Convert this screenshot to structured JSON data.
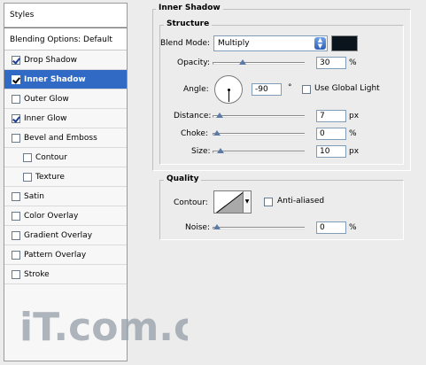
{
  "styles_panel": {
    "header": "Styles",
    "blending_options": "Blending Options: Default",
    "items": [
      {
        "label": "Drop Shadow",
        "checked": true
      },
      {
        "label": "Inner Shadow",
        "checked": true,
        "selected": true
      },
      {
        "label": "Outer Glow",
        "checked": false
      },
      {
        "label": "Inner Glow",
        "checked": true
      },
      {
        "label": "Bevel and Emboss",
        "checked": false
      },
      {
        "label": "Contour",
        "checked": false,
        "sub": true
      },
      {
        "label": "Texture",
        "checked": false,
        "sub": true
      },
      {
        "label": "Satin",
        "checked": false
      },
      {
        "label": "Color Overlay",
        "checked": false
      },
      {
        "label": "Gradient Overlay",
        "checked": false
      },
      {
        "label": "Pattern Overlay",
        "checked": false
      },
      {
        "label": "Stroke",
        "checked": false
      }
    ]
  },
  "inner_shadow": {
    "title": "Inner Shadow",
    "structure": {
      "title": "Structure",
      "blend_mode_label": "Blend Mode:",
      "blend_mode_value": "Multiply",
      "shadow_color": "#0a141c",
      "opacity_label": "Opacity:",
      "opacity_value": "30",
      "opacity_unit": "%",
      "opacity_fraction": 0.3,
      "angle_label": "Angle:",
      "angle_value": "-90",
      "angle_unit": "°",
      "use_global_light_label": "Use Global Light",
      "use_global_light_checked": false,
      "distance_label": "Distance:",
      "distance_value": "7",
      "distance_unit": "px",
      "distance_fraction": 0.035,
      "choke_label": "Choke:",
      "choke_value": "0",
      "choke_unit": "%",
      "choke_fraction": 0.0,
      "size_label": "Size:",
      "size_value": "10",
      "size_unit": "px",
      "size_fraction": 0.04
    },
    "quality": {
      "title": "Quality",
      "contour_label": "Contour:",
      "anti_aliased_label": "Anti-aliased",
      "anti_aliased_checked": false,
      "noise_label": "Noise:",
      "noise_value": "0",
      "noise_unit": "%",
      "noise_fraction": 0.0
    }
  },
  "watermark": "iT.com.cn",
  "colors": {
    "selection": "#316ac5",
    "watermark": "#9aa3ad"
  }
}
